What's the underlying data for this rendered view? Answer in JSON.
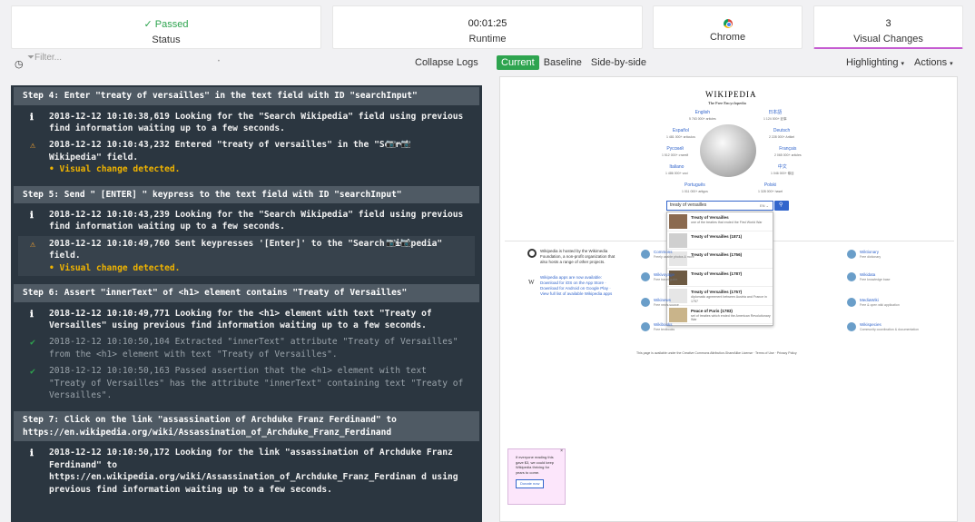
{
  "summary": {
    "status": {
      "value": "Passed",
      "check": "✓",
      "label": "Status"
    },
    "runtime": {
      "value": "00:01:25",
      "label": "Runtime"
    },
    "browser": {
      "label": "Chrome",
      "icon": "chrome-icon"
    },
    "visual_changes": {
      "value": "3",
      "label": "Visual Changes"
    }
  },
  "toolbar": {
    "filter_placeholder": "Filter...",
    "collapse_logs": "Collapse Logs",
    "view_tabs": [
      "Current",
      "Baseline",
      "Side-by-side"
    ],
    "highlighting": "Highlighting",
    "actions": "Actions"
  },
  "steps": [
    {
      "title": "Step 4: Enter \"treaty of versailles\" in the text field with ID \"searchInput\"",
      "entries": [
        {
          "type": "info",
          "text": "2018-12-12 10:10:38,619 Looking for the \"Search Wikipedia\" field using previous find information waiting up to a few seconds."
        },
        {
          "type": "warn",
          "text": "2018-12-12 10:10:43,232 Entered \"treaty of versailles\" in the \"Search Wikipedia\" field.",
          "sub": "• Visual change detected.",
          "cam": "📷⟷📷"
        }
      ]
    },
    {
      "title": "Step 5: Send \" [ENTER] \" keypress to the text field with ID \"searchInput\"",
      "entries": [
        {
          "type": "info",
          "text": "2018-12-12 10:10:43,239 Looking for the \"Search Wikipedia\" field using previous find information waiting up to a few seconds."
        },
        {
          "type": "warn",
          "hl": true,
          "text": "2018-12-12 10:10:49,760 Sent keypresses '[Enter]' to the \"Search Wikipedia\" field.",
          "sub": "• Visual change detected.",
          "cam": "📷⟷📷"
        }
      ]
    },
    {
      "title": "Step 6: Assert \"innerText\" of <h1> element contains \"Treaty of Versailles\"",
      "entries": [
        {
          "type": "info",
          "text": "2018-12-12 10:10:49,771 Looking for the <h1> element with text \"Treaty of Versailles\" using previous find information waiting up to a few seconds."
        },
        {
          "type": "pass",
          "text": "2018-12-12 10:10:50,104 Extracted \"innerText\" attribute \"Treaty of Versailles\" from the <h1> element with text \"Treaty of Versailles\"."
        },
        {
          "type": "pass",
          "text": "2018-12-12 10:10:50,163 Passed assertion that the <h1> element with text \"Treaty of Versailles\" has the attribute \"innerText\" containing text \"Treaty of Versailles\"."
        }
      ]
    },
    {
      "title": "Step 7: Click on the link \"assassination of Archduke Franz Ferdinand\" to https://en.wikipedia.org/wiki/Assassination_of_Archduke_Franz_Ferdinand",
      "entries": [
        {
          "type": "info",
          "text": "2018-12-12 10:10:50,172 Looking for the link \"assassination of Archduke Franz Ferdinand\" to https://en.wikipedia.org/wiki/Assassination_of_Archduke_Franz_Ferdinan d using previous find information waiting up to a few seconds."
        }
      ]
    }
  ],
  "preview": {
    "wiki_title": "WIKIPEDIA",
    "wiki_tagline": "The Free Encyclopedia",
    "languages": [
      {
        "name": "English",
        "count": "5 763 000+ articles"
      },
      {
        "name": "日本語",
        "count": "1 124 000+ 記事"
      },
      {
        "name": "Español",
        "count": "1 481 000+ artículos"
      },
      {
        "name": "Deutsch",
        "count": "2 228 000+ Artikel"
      },
      {
        "name": "Русский",
        "count": "1 512 000+ статей"
      },
      {
        "name": "Français",
        "count": "2 065 000+ articles"
      },
      {
        "name": "Italiano",
        "count": "1 486 000+ voci"
      },
      {
        "name": "中文",
        "count": "1 046 000+ 條目"
      },
      {
        "name": "Português",
        "count": "1 011 000+ artigos"
      },
      {
        "name": "Polski",
        "count": "1 328 000+ haseł"
      }
    ],
    "search_value": "treaty of versailles",
    "search_lang": "EN ⌄",
    "suggestions": [
      {
        "title": "Treaty of Versailles",
        "desc": "one of the treaties that ended the First World War"
      },
      {
        "title": "Treaty of Versailles (1871)",
        "desc": ""
      },
      {
        "title": "Treaty of Versailles (1756)",
        "desc": ""
      },
      {
        "title": "Treaty of Versailles (1787)",
        "desc": ""
      },
      {
        "title": "Treaty of Versailles (1757)",
        "desc": "diplomatic agreement between Austria and France in 1757"
      },
      {
        "title": "Peace of Paris (1783)",
        "desc": "set of treaties which ended the American Revolutionary War"
      }
    ],
    "info_1": "Wikipedia is hosted by the Wikimedia Foundation, a non-profit organization that also hosts a range of other projects.",
    "info_2": "Wikipedia apps are now available: Download for iOS on the App Store · Download for Android on Google Play · View full list of available Wikipedia apps",
    "projects_left": [
      {
        "name": "Commons",
        "desc": "Freely usable photos & more"
      },
      {
        "name": "Wikivoyage",
        "desc": "Free travel guide"
      },
      {
        "name": "Wikinews",
        "desc": "Free news source"
      },
      {
        "name": "Wikibooks",
        "desc": "Free textbooks"
      }
    ],
    "projects_right": [
      {
        "name": "Wiktionary",
        "desc": "Free dictionary"
      },
      {
        "name": "Wikidata",
        "desc": "Free knowledge base"
      },
      {
        "name": "MediaWiki",
        "desc": "Free & open wiki application"
      },
      {
        "name": "Wikispecies",
        "desc": "Community coordination & documentation"
      }
    ],
    "footer": "This page is available under the Creative Commons Attribution-ShareAlike License · Terms of Use · Privacy Policy",
    "donate_text": "If everyone reading this gave $3, we could keep Wikipedia thriving for years to come.",
    "donate_button": "Donate now"
  }
}
